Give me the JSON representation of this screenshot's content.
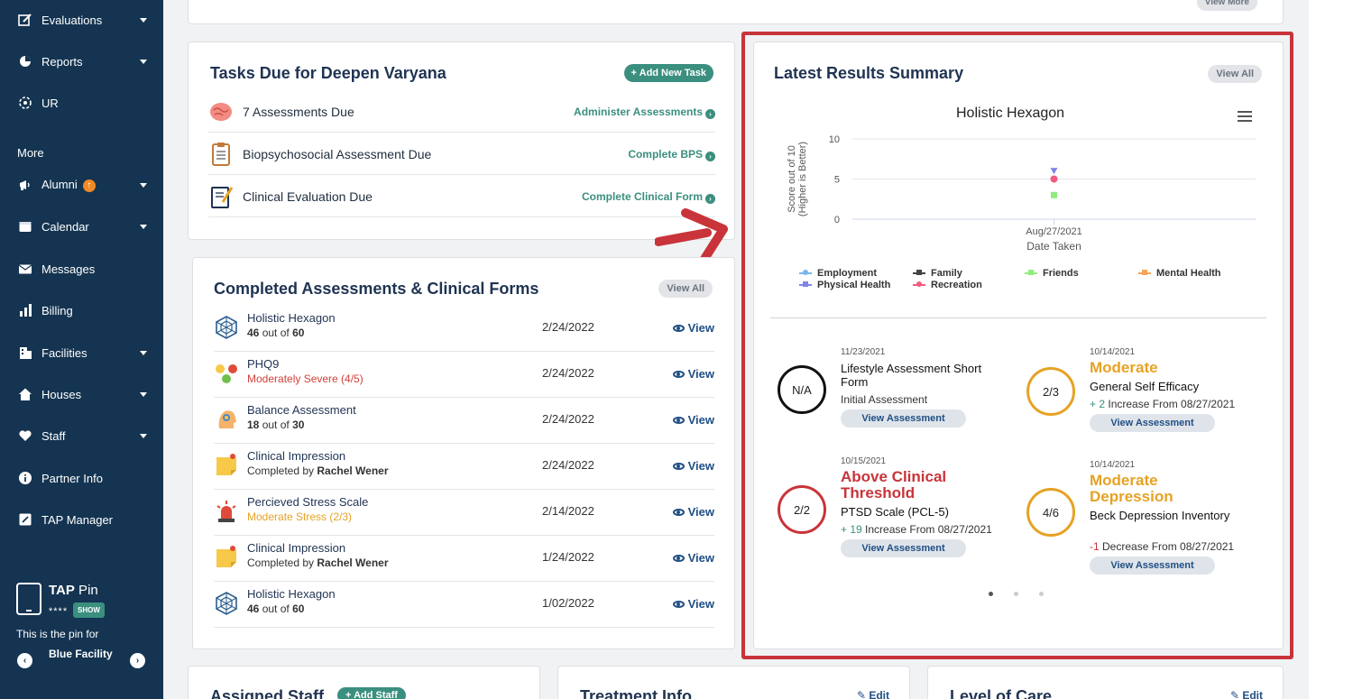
{
  "sidebar": {
    "items": [
      {
        "label": "Evaluations",
        "icon": "edit-icon",
        "caret": true
      },
      {
        "label": "Reports",
        "icon": "pie-chart-icon",
        "caret": true
      },
      {
        "label": "UR",
        "icon": "brain-settings-icon",
        "caret": false
      }
    ],
    "more_label": "More",
    "more_items": [
      {
        "label": "Alumni",
        "icon": "megaphone-icon",
        "caret": true
      },
      {
        "label": "Calendar",
        "icon": "calendar-icon",
        "caret": true
      },
      {
        "label": "Messages",
        "icon": "envelope-icon",
        "caret": false
      },
      {
        "label": "Billing",
        "icon": "bar-chart-icon",
        "caret": false
      },
      {
        "label": "Facilities",
        "icon": "building-icon",
        "caret": true
      },
      {
        "label": "Houses",
        "icon": "house-icon",
        "caret": true
      },
      {
        "label": "Staff",
        "icon": "heart-hand-icon",
        "caret": true
      },
      {
        "label": "Partner Info",
        "icon": "info-icon",
        "caret": false
      },
      {
        "label": "TAP Manager",
        "icon": "tap-manager-icon",
        "caret": false
      }
    ],
    "alumni_badge": "↑",
    "tap_pin": {
      "title_bold": "TAP",
      "title_rest": " Pin",
      "masked_pin": "****",
      "show_label": "SHOW",
      "note": "This is the pin for",
      "facility": "Blue Facility"
    }
  },
  "top_card": {
    "view_more": "View More"
  },
  "tasks": {
    "title": "Tasks Due for Deepen Varyana",
    "add_label": "+ Add New Task",
    "rows": [
      {
        "label": "7 Assessments Due",
        "action": "Administer Assessments",
        "icon": "brain-icon"
      },
      {
        "label": "Biopsychosocial Assessment Due",
        "action": "Complete BPS",
        "icon": "clipboard-icon"
      },
      {
        "label": "Clinical Evaluation Due",
        "action": "Complete Clinical Form",
        "icon": "clinical-form-icon"
      }
    ]
  },
  "completed": {
    "title": "Completed Assessments & Clinical Forms",
    "view_all": "View All",
    "view_label": "View",
    "rows": [
      {
        "name": "Holistic Hexagon",
        "sub_pre": "",
        "sub_bold": "46",
        "sub_mid": " out of ",
        "sub_bold2": "60",
        "sub_color": "",
        "date": "2/24/2022",
        "icon": "hexagon-web-icon"
      },
      {
        "name": "PHQ9",
        "sub_pre": "Moderately Severe (4/5)",
        "sub_bold": "",
        "sub_mid": "",
        "sub_bold2": "",
        "sub_color": "#d3403a",
        "date": "2/24/2022",
        "icon": "emoji-faces-icon"
      },
      {
        "name": "Balance Assessment",
        "sub_pre": "",
        "sub_bold": "18",
        "sub_mid": " out of ",
        "sub_bold2": "30",
        "sub_color": "",
        "date": "2/24/2022",
        "icon": "head-balance-icon"
      },
      {
        "name": "Clinical Impression",
        "sub_pre": "Completed by ",
        "sub_bold": "",
        "sub_mid": "",
        "sub_bold2": "Rachel Wener",
        "sub_color": "",
        "date": "2/24/2022",
        "icon": "sticky-note-icon"
      },
      {
        "name": "Percieved Stress Scale",
        "sub_pre": "Moderate Stress (2/3)",
        "sub_bold": "",
        "sub_mid": "",
        "sub_bold2": "",
        "sub_color": "#e6a224",
        "date": "2/14/2022",
        "icon": "alarm-light-icon"
      },
      {
        "name": "Clinical Impression",
        "sub_pre": "Completed by ",
        "sub_bold": "",
        "sub_mid": "",
        "sub_bold2": "Rachel Wener",
        "sub_color": "",
        "date": "1/24/2022",
        "icon": "sticky-note-icon"
      },
      {
        "name": "Holistic Hexagon",
        "sub_pre": "",
        "sub_bold": "46",
        "sub_mid": " out of ",
        "sub_bold2": "60",
        "sub_color": "",
        "date": "1/02/2022",
        "icon": "hexagon-web-icon"
      }
    ]
  },
  "latest": {
    "title": "Latest Results Summary",
    "view_all": "View All",
    "view_assessment": "View Assessment",
    "results": [
      {
        "circle": "N/A",
        "ring": "#111111",
        "date": "11/23/2021",
        "status": "",
        "status_color": "",
        "name": "Lifestyle Assessment Short Form",
        "change_sign": "",
        "change_num": "",
        "change_text": "Initial Assessment",
        "change_dir": ""
      },
      {
        "circle": "2/3",
        "ring": "#e6a224",
        "date": "10/14/2021",
        "status": "Moderate",
        "status_color": "#e6a224",
        "name": "General Self Efficacy",
        "change_sign": "+ ",
        "change_num": "2",
        "change_text": " Increase From 08/27/2021",
        "change_dir": "up"
      },
      {
        "circle": "2/2",
        "ring": "#c8343a",
        "date": "10/15/2021",
        "status": "Above Clinical Threshold",
        "status_color": "#c8343a",
        "name": "PTSD Scale (PCL-5)",
        "change_sign": "+ ",
        "change_num": "19",
        "change_text": " Increase From 08/27/2021",
        "change_dir": "up"
      },
      {
        "circle": "4/6",
        "ring": "#e6a224",
        "date": "10/14/2021",
        "status": "Moderate Depression",
        "status_color": "#e6a224",
        "name": "Beck Depression Inventory",
        "change_sign": "",
        "change_num": "-1",
        "change_text": " Decrease From 08/27/2021",
        "change_dir": "down"
      }
    ],
    "carousel_dots": 3,
    "carousel_active": 0
  },
  "chart_data": {
    "type": "scatter",
    "title": "Holistic Hexagon",
    "xlabel": "Date Taken",
    "ylabel": "Score out of 10 (Higher is Better)",
    "x_categories": [
      "Aug/27/2021"
    ],
    "y_ticks": [
      0,
      5,
      10
    ],
    "ylim": [
      0,
      10
    ],
    "grid": true,
    "legend_position": "bottom",
    "series": [
      {
        "name": "Employment",
        "color": "#7cb5ec",
        "marker": "circle",
        "values": [
          null
        ]
      },
      {
        "name": "Family",
        "color": "#434348",
        "marker": "diamond",
        "values": [
          null
        ]
      },
      {
        "name": "Friends",
        "color": "#90ed7d",
        "marker": "square",
        "values": [
          3
        ]
      },
      {
        "name": "Mental Health",
        "color": "#f7a35c",
        "marker": "triangle",
        "values": [
          null
        ]
      },
      {
        "name": "Physical Health",
        "color": "#8085e9",
        "marker": "triangle-down",
        "values": [
          6
        ]
      },
      {
        "name": "Recreation",
        "color": "#f15c80",
        "marker": "circle",
        "values": [
          5
        ]
      }
    ]
  },
  "bottom_cards": [
    {
      "title": "Assigned Staff",
      "action": "+ Add Staff"
    },
    {
      "title": "Treatment Info",
      "action": "Edit"
    },
    {
      "title": "Level of Care",
      "action": "Edit"
    }
  ]
}
